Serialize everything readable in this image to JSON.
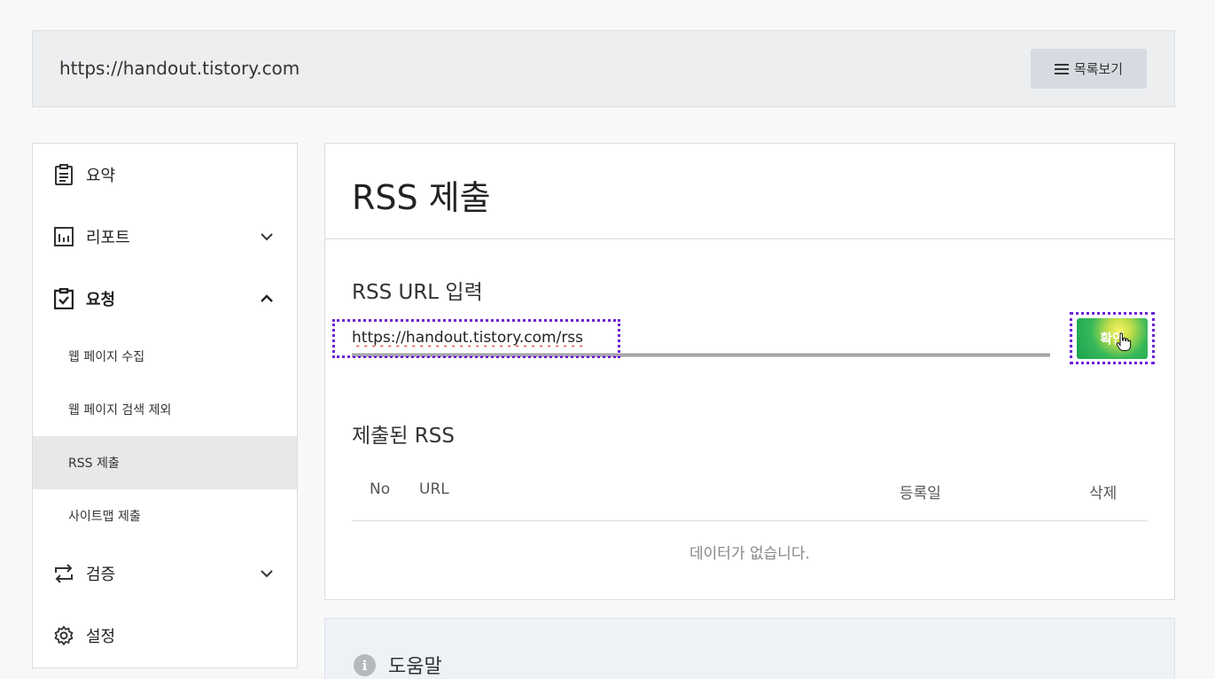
{
  "site": {
    "url": "https://handout.tistory.com",
    "list_button": "목록보기"
  },
  "sidebar": {
    "summary": "요약",
    "report": "리포트",
    "request": "요청",
    "request_items": [
      "웹 페이지 수집",
      "웹 페이지 검색 제외",
      "RSS 제출",
      "사이트맵 제출"
    ],
    "verify": "검증",
    "settings": "설정"
  },
  "main": {
    "title": "RSS 제출",
    "input_label": "RSS URL 입력",
    "input_value": "https://handout.tistory.com/rss",
    "confirm_button": "확인",
    "submitted_title": "제출된 RSS",
    "columns": {
      "no": "No",
      "url": "URL",
      "registered": "등록일",
      "delete": "삭제"
    },
    "empty_message": "데이터가 없습니다."
  },
  "help": {
    "title": "도움말",
    "icon_glyph": "i"
  },
  "colors": {
    "accent_green": "#19a34f",
    "focus_outline": "#6d22d6"
  }
}
